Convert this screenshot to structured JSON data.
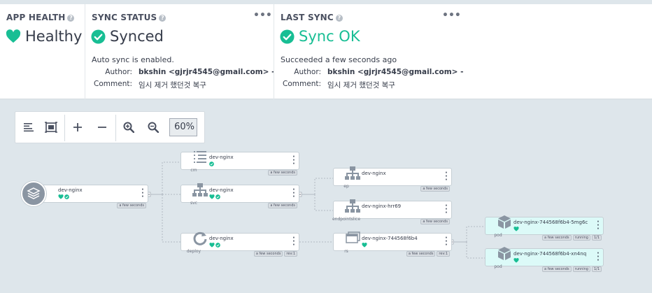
{
  "summary": {
    "health": {
      "title": "APP HEALTH",
      "status": "Healthy"
    },
    "sync": {
      "title": "SYNC STATUS",
      "status": "Synced",
      "message": "Auto sync is enabled.",
      "author_label": "Author:",
      "author": "bkshin <gjrjr4545@gmail.com> -",
      "comment_label": "Comment:",
      "comment": "임시 제거 했던것 복구"
    },
    "last_sync": {
      "title": "LAST SYNC",
      "status": "Sync OK",
      "message": "Succeeded a few seconds ago",
      "author_label": "Author:",
      "author": "bkshin <gjrjr4545@gmail.com> -",
      "comment_label": "Comment:",
      "comment": "임시 제거 했던것 복구"
    },
    "menu_glyph": "•••",
    "help_glyph": "?"
  },
  "toolbar": {
    "zoom": "60%",
    "buttons": [
      "list-view-icon",
      "fit-view-icon",
      "zoom-in-icon",
      "zoom-out-icon",
      "zoom-in-glass-icon",
      "zoom-out-glass-icon"
    ]
  },
  "colors": {
    "healthy": "#18be94",
    "text": "#363c4a",
    "canvas": "#dee6eb",
    "pod_bg": "#dcfaf8"
  },
  "tree": {
    "root": {
      "name": "dev-nginx",
      "age": "a few seconds"
    },
    "nodes": [
      {
        "name": "dev-nginx",
        "kind": "cm",
        "age": "a few seconds"
      },
      {
        "name": "dev-nginx",
        "kind": "svc",
        "age": "a few seconds"
      },
      {
        "name": "dev-nginx",
        "kind": "deploy",
        "age": "a few seconds",
        "rev": "rev:1"
      },
      {
        "name": "dev-nginx",
        "kind": "ep",
        "age": "a few seconds"
      },
      {
        "name": "dev-nginx-hrr69",
        "kind": "endpointslice",
        "age": "a few seconds"
      },
      {
        "name": "dev-nginx-744568f6b4",
        "kind": "rs",
        "age": "a few seconds",
        "rev": "rev:1"
      },
      {
        "name": "dev-nginx-744568f6b4-5mg6c",
        "kind": "pod",
        "age": "a few seconds",
        "state": "running",
        "ready": "1/1"
      },
      {
        "name": "dev-nginx-744568f6b4-xn4nq",
        "kind": "pod",
        "age": "a few seconds",
        "state": "running",
        "ready": "1/1"
      }
    ]
  }
}
